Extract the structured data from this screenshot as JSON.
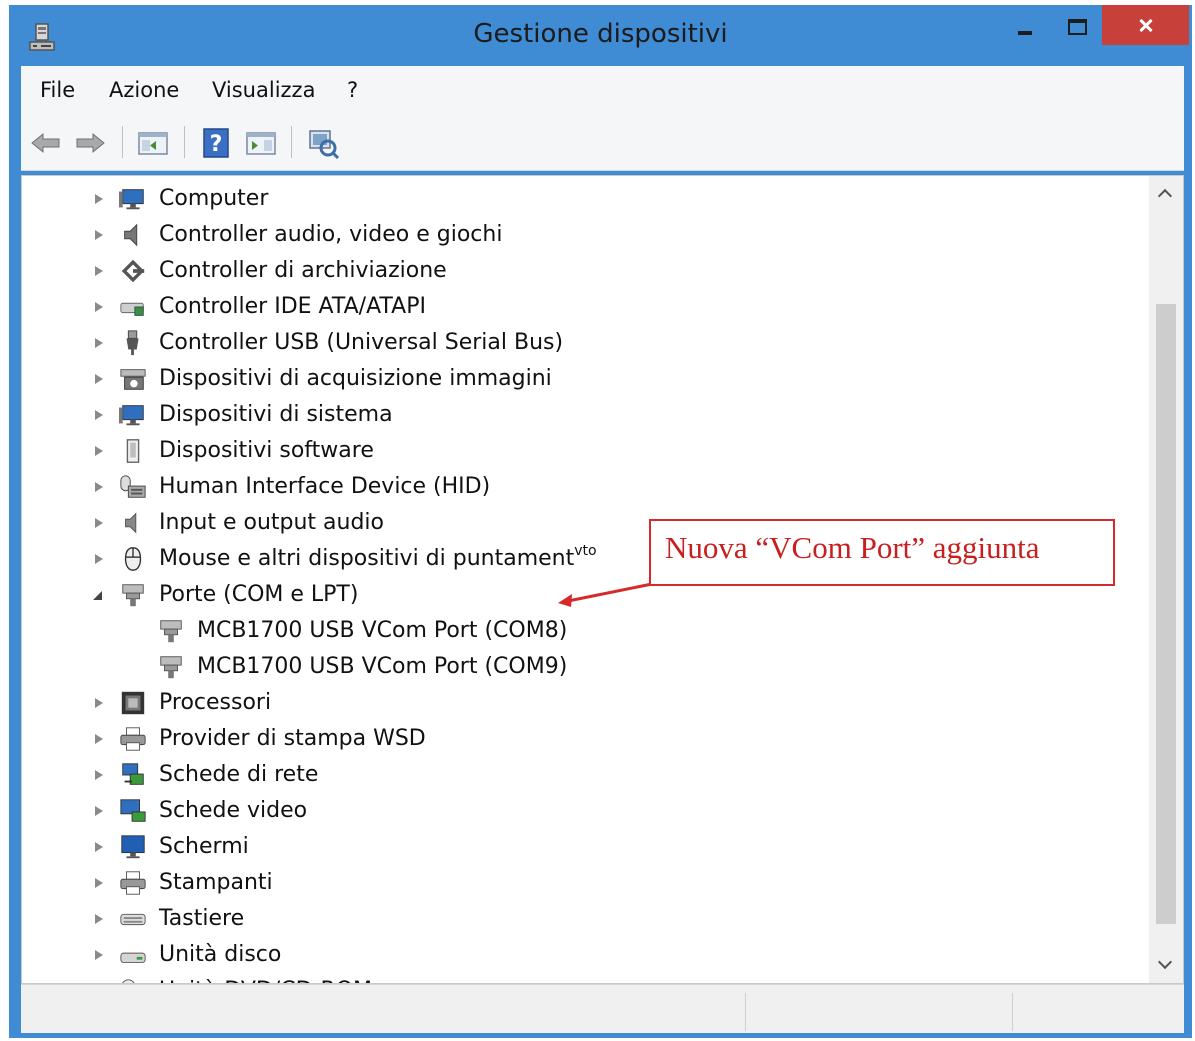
{
  "window": {
    "title": "Gestione dispositivi"
  },
  "menu": [
    "File",
    "Azione",
    "Visualizza",
    "?"
  ],
  "toolbar": {
    "buttons": [
      "back-arrow-icon",
      "forward-arrow-icon",
      "console-tree-icon",
      "help-icon",
      "properties-icon",
      "scan-hardware-icon"
    ]
  },
  "tree": [
    {
      "label": "Computer",
      "icon": "computer-icon",
      "level": 0,
      "state": "collapsed"
    },
    {
      "label": "Controller audio, video e giochi",
      "icon": "speaker-icon",
      "level": 0,
      "state": "collapsed"
    },
    {
      "label": "Controller di archiviazione",
      "icon": "storage-controller-icon",
      "level": 0,
      "state": "collapsed"
    },
    {
      "label": "Controller IDE ATA/ATAPI",
      "icon": "ide-controller-icon",
      "level": 0,
      "state": "collapsed"
    },
    {
      "label": "Controller USB (Universal Serial Bus)",
      "icon": "usb-icon",
      "level": 0,
      "state": "collapsed"
    },
    {
      "label": "Dispositivi di acquisizione immagini",
      "icon": "scanner-camera-icon",
      "level": 0,
      "state": "collapsed"
    },
    {
      "label": "Dispositivi di sistema",
      "icon": "system-device-icon",
      "level": 0,
      "state": "collapsed"
    },
    {
      "label": "Dispositivi software",
      "icon": "software-device-icon",
      "level": 0,
      "state": "collapsed"
    },
    {
      "label": "Human Interface Device (HID)",
      "icon": "hid-icon",
      "level": 0,
      "state": "collapsed"
    },
    {
      "label": "Input e output audio",
      "icon": "audio-io-icon",
      "level": 0,
      "state": "collapsed"
    },
    {
      "label": "Mouse e altri dispositivi di puntament",
      "suffix": "vto",
      "icon": "mouse-icon",
      "level": 0,
      "state": "collapsed"
    },
    {
      "label": "Porte (COM e LPT)",
      "icon": "port-icon",
      "level": 0,
      "state": "expanded"
    },
    {
      "label": "MCB1700 USB VCom Port (COM8)",
      "icon": "port-icon",
      "level": 1,
      "state": "none"
    },
    {
      "label": "MCB1700 USB VCom Port (COM9)",
      "icon": "port-icon",
      "level": 1,
      "state": "none"
    },
    {
      "label": "Processori",
      "icon": "processor-icon",
      "level": 0,
      "state": "collapsed"
    },
    {
      "label": "Provider di stampa WSD",
      "icon": "printer-icon",
      "level": 0,
      "state": "collapsed"
    },
    {
      "label": "Schede di rete",
      "icon": "network-adapter-icon",
      "level": 0,
      "state": "collapsed"
    },
    {
      "label": "Schede video",
      "icon": "display-adapter-icon",
      "level": 0,
      "state": "collapsed"
    },
    {
      "label": "Schermi",
      "icon": "monitor-icon",
      "level": 0,
      "state": "collapsed"
    },
    {
      "label": "Stampanti",
      "icon": "printer-icon",
      "level": 0,
      "state": "collapsed"
    },
    {
      "label": "Tastiere",
      "icon": "keyboard-icon",
      "level": 0,
      "state": "collapsed"
    },
    {
      "label": "Unità disco",
      "icon": "disk-drive-icon",
      "level": 0,
      "state": "collapsed"
    },
    {
      "label": "Unità DVD/CD-ROM",
      "icon": "dvd-drive-icon",
      "level": 0,
      "state": "collapsed"
    }
  ],
  "annotation": {
    "text": "Nuova “VCom Port” aggiunta",
    "color": "#c81e1e"
  },
  "colors": {
    "titlebar": "#3f8bd4",
    "close_button": "#c7403a"
  }
}
